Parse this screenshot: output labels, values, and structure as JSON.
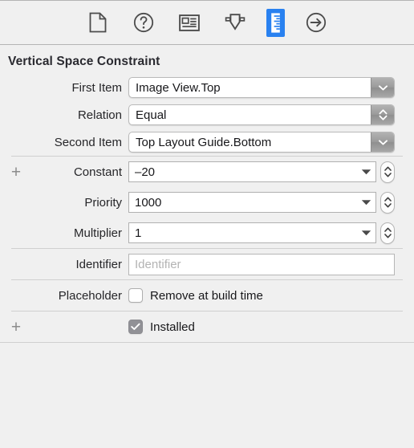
{
  "toolbar": {
    "items": [
      {
        "name": "file-icon",
        "label": "File inspector",
        "selected": false
      },
      {
        "name": "help-icon",
        "label": "Quick Help inspector",
        "selected": false
      },
      {
        "name": "identity-card-icon",
        "label": "Identity inspector",
        "selected": false
      },
      {
        "name": "attributes-shield-icon",
        "label": "Attributes inspector",
        "selected": false
      },
      {
        "name": "ruler-icon",
        "label": "Size inspector",
        "selected": true
      },
      {
        "name": "connections-arrow-icon",
        "label": "Connections inspector",
        "selected": false
      }
    ],
    "selected_accent": "#2981f0"
  },
  "section": {
    "title": "Vertical Space Constraint"
  },
  "fields": {
    "first_item": {
      "label": "First Item",
      "value": "Image View.Top"
    },
    "relation": {
      "label": "Relation",
      "value": "Equal"
    },
    "second_item": {
      "label": "Second Item",
      "value": "Top Layout Guide.Bottom"
    },
    "constant": {
      "label": "Constant",
      "value": "–20",
      "add_label": "+"
    },
    "priority": {
      "label": "Priority",
      "value": "1000"
    },
    "multiplier": {
      "label": "Multiplier",
      "value": "1"
    },
    "identifier": {
      "label": "Identifier",
      "placeholder": "Identifier",
      "value": ""
    },
    "placeholder": {
      "label": "Placeholder",
      "checkbox_label": "Remove at build time",
      "checked": false
    },
    "installed": {
      "label": "",
      "checkbox_label": "Installed",
      "checked": true,
      "add_label": "+"
    }
  }
}
